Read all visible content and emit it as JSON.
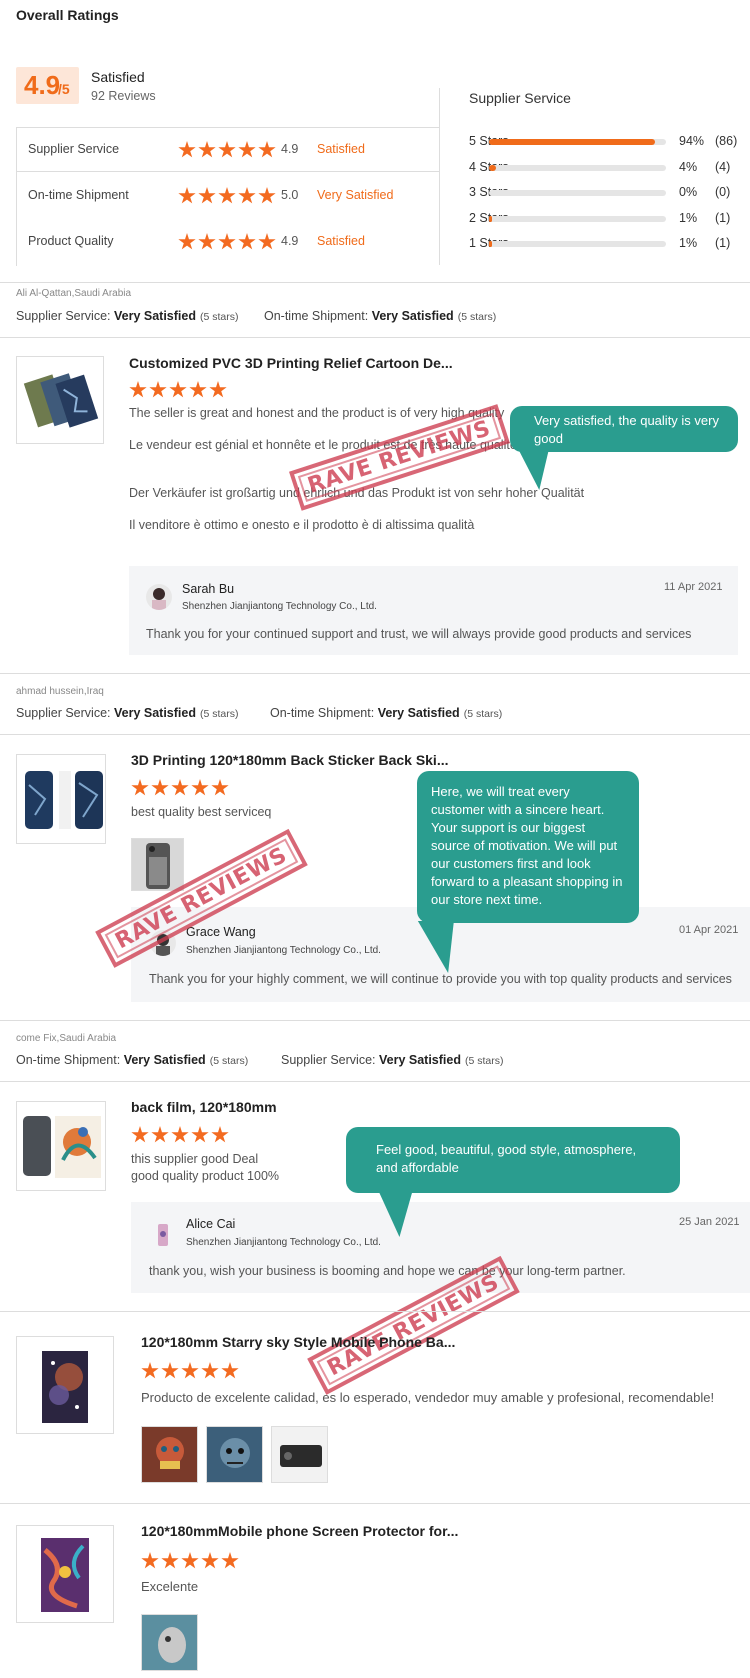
{
  "overall": {
    "title": "Overall Ratings",
    "score": "4.9",
    "score_den": "/5",
    "satisfaction": "Satisfied",
    "reviews": "92 Reviews",
    "rows": [
      {
        "label": "Supplier Service",
        "stars": 5,
        "score": "4.9",
        "status": "Satisfied"
      },
      {
        "label": "On-time Shipment",
        "stars": 5,
        "score": "5.0",
        "status": "Very Satisfied"
      },
      {
        "label": "Product Quality",
        "stars": 5,
        "score": "4.9",
        "status": "Satisfied"
      }
    ]
  },
  "supplier_service": {
    "title": "Supplier Service",
    "bars": [
      {
        "label": "5 Stars",
        "fraction": 0.94,
        "pct": "94%",
        "count": "(86)"
      },
      {
        "label": "4 Stars",
        "fraction": 0.04,
        "pct": "4%",
        "count": "(4)"
      },
      {
        "label": "3 Stars",
        "fraction": 0.0,
        "pct": "0%",
        "count": "(0)"
      },
      {
        "label": "2 Stars",
        "fraction": 0.01,
        "pct": "1%",
        "count": "(1)"
      },
      {
        "label": "1 Stars",
        "fraction": 0.01,
        "pct": "1%",
        "count": "(1)"
      }
    ]
  },
  "reviews": [
    {
      "reviewer": "Ali Al-Qattan,Saudi Arabia",
      "svc1_label": "Supplier Service:",
      "svc1_value": "Very Satisfied",
      "svc1_stars": "(5 stars)",
      "svc2_label": "On-time Shipment:",
      "svc2_value": "Very Satisfied",
      "svc2_stars": "(5 stars)",
      "product": "Customized PVC 3D Printing Relief Cartoon De...",
      "texts": [
        "The seller is great and honest and the product is of very high quality",
        "Le vendeur est génial et honnête et le produit est de très haute qualité",
        "Der Verkäufer ist großartig und ehrlich und das Produkt ist von sehr hoher Qualität",
        "Il venditore è ottimo e onesto e il prodotto è di altissima qualità"
      ],
      "reply_name": "Sarah Bu",
      "reply_company": "Shenzhen Jianjiantong Technology Co., Ltd.",
      "reply_date": "11 Apr 2021",
      "reply_text": "Thank you for your continued support and trust, we will always provide good products and services",
      "bubble": "Very satisfied, the quality is very good"
    },
    {
      "reviewer": "ahmad hussein,Iraq",
      "svc1_label": "Supplier Service:",
      "svc1_value": "Very Satisfied",
      "svc1_stars": "(5 stars)",
      "svc2_label": "On-time Shipment:",
      "svc2_value": "Very Satisfied",
      "svc2_stars": "(5 stars)",
      "product": "3D Printing 120*180mm Back Sticker Back Ski...",
      "texts": [
        "best quality best serviceq"
      ],
      "reply_name": "Grace Wang",
      "reply_company": "Shenzhen Jianjiantong Technology Co., Ltd.",
      "reply_date": "01 Apr 2021",
      "reply_text": "Thank you for your highly comment, we will continue to provide you with top quality products and services",
      "bubble": "Here, we will treat every customer with a sincere heart. Your support is our biggest source of motivation. We will put our customers first and look forward to a pleasant shopping in our store next time."
    },
    {
      "reviewer": "come Fix,Saudi Arabia",
      "svc1_label": "On-time Shipment:",
      "svc1_value": "Very Satisfied",
      "svc1_stars": "(5 stars)",
      "svc2_label": "Supplier Service:",
      "svc2_value": "Very Satisfied",
      "svc2_stars": "(5 stars)",
      "product": "back film, 120*180mm",
      "texts": [
        "this supplier good Deal",
        "good quality product 100%"
      ],
      "reply_name": "Alice Cai",
      "reply_company": "Shenzhen Jianjiantong Technology Co., Ltd.",
      "reply_date": "25 Jan 2021",
      "reply_text": "thank you, wish your business is booming and hope we can be your long-term partner.",
      "bubble": "Feel good, beautiful, good style, atmosphere, and affordable"
    },
    {
      "product": "120*180mm Starry sky Style Mobile Phone Ba...",
      "texts": [
        "Producto de excelente calidad, es lo esperado, vendedor muy amable y profesional, recomendable!"
      ]
    },
    {
      "product": "120*180mmMobile phone Screen Protector for...",
      "texts": [
        "Excelente"
      ]
    }
  ],
  "stamp_text": "RAVE REVIEWS",
  "colors": {
    "accent": "#f06b1a",
    "bubble": "#2a9d8f",
    "stamp": "#cd3c50"
  }
}
